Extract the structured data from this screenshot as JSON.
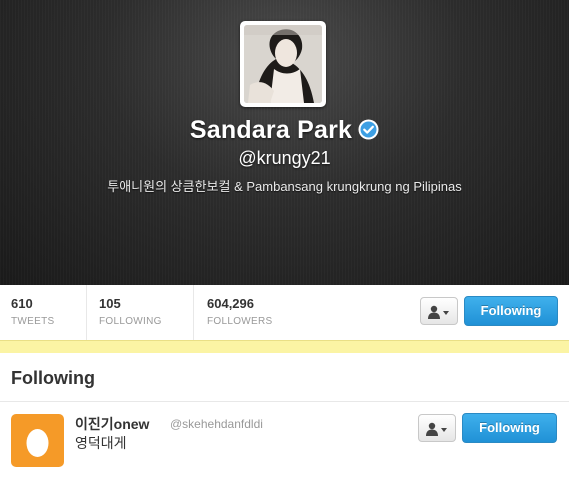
{
  "profile": {
    "display_name": "Sandara Park",
    "handle": "@krungy21",
    "bio": "투애니원의 상큼한보컬 & Pambansang krungkrung ng Pilipinas",
    "verified": true
  },
  "stats": [
    {
      "value": "610",
      "label": "TWEETS"
    },
    {
      "value": "105",
      "label": "FOLLOWING"
    },
    {
      "value": "604,296",
      "label": "FOLLOWERS"
    }
  ],
  "actions": {
    "follow_label": "Following"
  },
  "section": {
    "title": "Following"
  },
  "following_list": [
    {
      "name": "이진기onew",
      "handle": "@skehehdanfdldi",
      "bio": "영덕대게",
      "follow_label": "Following"
    }
  ],
  "colors": {
    "accent_blue": "#2091d6",
    "default_avatar": "#f59a28",
    "notice_bar": "#fbf4a4"
  }
}
